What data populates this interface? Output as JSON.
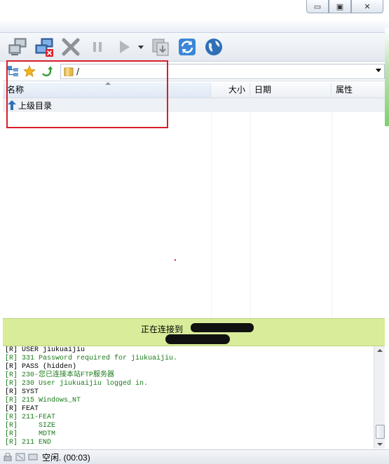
{
  "window": {
    "min_glyph": "▭",
    "max_glyph": "▣",
    "close_glyph": "✕"
  },
  "toolbar": {
    "icons": [
      "connect-icon",
      "disconnect-icon",
      "stop-icon",
      "pause-icon",
      "play-icon",
      "play-dropdown-icon",
      "transfer-icon",
      "refresh-icon",
      "globe-icon"
    ]
  },
  "address": {
    "path": "/"
  },
  "columns": {
    "name": "名称",
    "size": "大小",
    "date": "日期",
    "attr": "属性"
  },
  "list": {
    "parent_dir": "上级目录"
  },
  "banner": {
    "text": "正在连接到"
  },
  "log": [
    {
      "text": "[R] USER jiukuaijiu",
      "color": "#000000"
    },
    {
      "text": "[R] 331 Password required for jiukuaijiu.",
      "color": "#1a7a1a"
    },
    {
      "text": "[R] PASS (hidden)",
      "color": "#000000"
    },
    {
      "text": "[R] 230-您已连接本站FTP服务器",
      "color": "#1a7a1a"
    },
    {
      "text": "[R] 230 User jiukuaijiu logged in.",
      "color": "#1a7a1a"
    },
    {
      "text": "[R] SYST",
      "color": "#000000"
    },
    {
      "text": "[R] 215 Windows_NT",
      "color": "#1a7a1a"
    },
    {
      "text": "[R] FEAT",
      "color": "#000000"
    },
    {
      "text": "[R] 211-FEAT",
      "color": "#1a7a1a"
    },
    {
      "text": "[R]     SIZE",
      "color": "#1a7a1a"
    },
    {
      "text": "[R]     MDTM",
      "color": "#1a7a1a"
    },
    {
      "text": "[R] 211 END",
      "color": "#1a7a1a"
    }
  ],
  "status": {
    "text": "空闲. (00:03)"
  }
}
